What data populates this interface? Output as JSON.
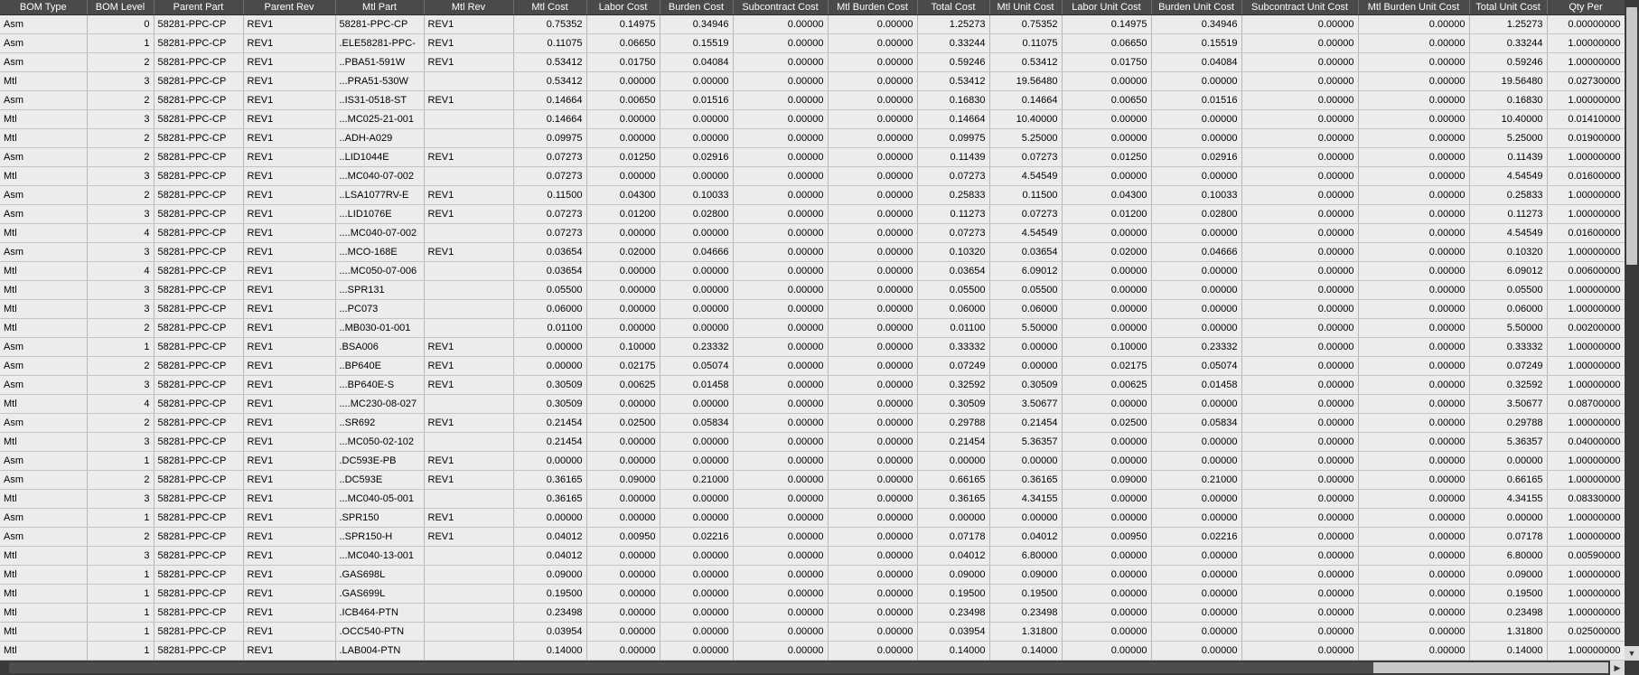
{
  "columns": [
    {
      "key": "bom_type",
      "label": "BOM Type",
      "width": 96,
      "align": "txt"
    },
    {
      "key": "bom_level",
      "label": "BOM Level",
      "width": 74,
      "align": "num"
    },
    {
      "key": "parent_part",
      "label": "Parent Part",
      "width": 99,
      "align": "txt"
    },
    {
      "key": "parent_rev",
      "label": "Parent Rev",
      "width": 102,
      "align": "txt"
    },
    {
      "key": "mtl_part",
      "label": "Mtl Part",
      "width": 98,
      "align": "txt"
    },
    {
      "key": "mtl_rev",
      "label": "Mtl Rev",
      "width": 99,
      "align": "txt"
    },
    {
      "key": "mtl_cost",
      "label": "Mtl Cost",
      "width": 81,
      "align": "num"
    },
    {
      "key": "labor_cost",
      "label": "Labor Cost",
      "width": 81,
      "align": "num"
    },
    {
      "key": "burden_cost",
      "label": "Burden Cost",
      "width": 81,
      "align": "num"
    },
    {
      "key": "subcontract_cost",
      "label": "Subcontract Cost",
      "width": 105,
      "align": "num"
    },
    {
      "key": "mtl_burden_cost",
      "label": "Mtl Burden Cost",
      "width": 99,
      "align": "num"
    },
    {
      "key": "total_cost",
      "label": "Total Cost",
      "width": 80,
      "align": "num"
    },
    {
      "key": "mtl_unit_cost",
      "label": "Mtl Unit Cost",
      "width": 80,
      "align": "num"
    },
    {
      "key": "labor_unit_cost",
      "label": "Labor Unit Cost",
      "width": 99,
      "align": "num"
    },
    {
      "key": "burden_unit_cost",
      "label": "Burden Unit Cost",
      "width": 100,
      "align": "num"
    },
    {
      "key": "subcontract_unit_cost",
      "label": "Subcontract Unit Cost",
      "width": 129,
      "align": "num"
    },
    {
      "key": "mtl_burden_unit_cost",
      "label": "Mtl Burden Unit Cost",
      "width": 123,
      "align": "num"
    },
    {
      "key": "total_unit_cost",
      "label": "Total Unit Cost",
      "width": 86,
      "align": "num"
    },
    {
      "key": "qty_per",
      "label": "Qty Per",
      "width": 86,
      "align": "num"
    }
  ],
  "rows": [
    [
      "Asm",
      "0",
      "58281-PPC-CP",
      "REV1",
      "58281-PPC-CP",
      "REV1",
      "0.75352",
      "0.14975",
      "0.34946",
      "0.00000",
      "0.00000",
      "1.25273",
      "0.75352",
      "0.14975",
      "0.34946",
      "0.00000",
      "0.00000",
      "1.25273",
      "0.00000000"
    ],
    [
      "Asm",
      "1",
      "58281-PPC-CP",
      "REV1",
      ".ELE58281-PPC-",
      "REV1",
      "0.11075",
      "0.06650",
      "0.15519",
      "0.00000",
      "0.00000",
      "0.33244",
      "0.11075",
      "0.06650",
      "0.15519",
      "0.00000",
      "0.00000",
      "0.33244",
      "1.00000000"
    ],
    [
      "Asm",
      "2",
      "58281-PPC-CP",
      "REV1",
      "..PBA51-591W",
      "REV1",
      "0.53412",
      "0.01750",
      "0.04084",
      "0.00000",
      "0.00000",
      "0.59246",
      "0.53412",
      "0.01750",
      "0.04084",
      "0.00000",
      "0.00000",
      "0.59246",
      "1.00000000"
    ],
    [
      "Mtl",
      "3",
      "58281-PPC-CP",
      "REV1",
      "...PRA51-530W",
      "",
      "0.53412",
      "0.00000",
      "0.00000",
      "0.00000",
      "0.00000",
      "0.53412",
      "19.56480",
      "0.00000",
      "0.00000",
      "0.00000",
      "0.00000",
      "19.56480",
      "0.02730000"
    ],
    [
      "Asm",
      "2",
      "58281-PPC-CP",
      "REV1",
      "..IS31-0518-ST",
      "REV1",
      "0.14664",
      "0.00650",
      "0.01516",
      "0.00000",
      "0.00000",
      "0.16830",
      "0.14664",
      "0.00650",
      "0.01516",
      "0.00000",
      "0.00000",
      "0.16830",
      "1.00000000"
    ],
    [
      "Mtl",
      "3",
      "58281-PPC-CP",
      "REV1",
      "...MC025-21-001",
      "",
      "0.14664",
      "0.00000",
      "0.00000",
      "0.00000",
      "0.00000",
      "0.14664",
      "10.40000",
      "0.00000",
      "0.00000",
      "0.00000",
      "0.00000",
      "10.40000",
      "0.01410000"
    ],
    [
      "Mtl",
      "2",
      "58281-PPC-CP",
      "REV1",
      "..ADH-A029",
      "",
      "0.09975",
      "0.00000",
      "0.00000",
      "0.00000",
      "0.00000",
      "0.09975",
      "5.25000",
      "0.00000",
      "0.00000",
      "0.00000",
      "0.00000",
      "5.25000",
      "0.01900000"
    ],
    [
      "Asm",
      "2",
      "58281-PPC-CP",
      "REV1",
      "..LID1044E",
      "REV1",
      "0.07273",
      "0.01250",
      "0.02916",
      "0.00000",
      "0.00000",
      "0.11439",
      "0.07273",
      "0.01250",
      "0.02916",
      "0.00000",
      "0.00000",
      "0.11439",
      "1.00000000"
    ],
    [
      "Mtl",
      "3",
      "58281-PPC-CP",
      "REV1",
      "...MC040-07-002",
      "",
      "0.07273",
      "0.00000",
      "0.00000",
      "0.00000",
      "0.00000",
      "0.07273",
      "4.54549",
      "0.00000",
      "0.00000",
      "0.00000",
      "0.00000",
      "4.54549",
      "0.01600000"
    ],
    [
      "Asm",
      "2",
      "58281-PPC-CP",
      "REV1",
      "..LSA1077RV-E",
      "REV1",
      "0.11500",
      "0.04300",
      "0.10033",
      "0.00000",
      "0.00000",
      "0.25833",
      "0.11500",
      "0.04300",
      "0.10033",
      "0.00000",
      "0.00000",
      "0.25833",
      "1.00000000"
    ],
    [
      "Asm",
      "3",
      "58281-PPC-CP",
      "REV1",
      "...LID1076E",
      "REV1",
      "0.07273",
      "0.01200",
      "0.02800",
      "0.00000",
      "0.00000",
      "0.11273",
      "0.07273",
      "0.01200",
      "0.02800",
      "0.00000",
      "0.00000",
      "0.11273",
      "1.00000000"
    ],
    [
      "Mtl",
      "4",
      "58281-PPC-CP",
      "REV1",
      "....MC040-07-002",
      "",
      "0.07273",
      "0.00000",
      "0.00000",
      "0.00000",
      "0.00000",
      "0.07273",
      "4.54549",
      "0.00000",
      "0.00000",
      "0.00000",
      "0.00000",
      "4.54549",
      "0.01600000"
    ],
    [
      "Asm",
      "3",
      "58281-PPC-CP",
      "REV1",
      "...MCO-168E",
      "REV1",
      "0.03654",
      "0.02000",
      "0.04666",
      "0.00000",
      "0.00000",
      "0.10320",
      "0.03654",
      "0.02000",
      "0.04666",
      "0.00000",
      "0.00000",
      "0.10320",
      "1.00000000"
    ],
    [
      "Mtl",
      "4",
      "58281-PPC-CP",
      "REV1",
      "....MC050-07-006",
      "",
      "0.03654",
      "0.00000",
      "0.00000",
      "0.00000",
      "0.00000",
      "0.03654",
      "6.09012",
      "0.00000",
      "0.00000",
      "0.00000",
      "0.00000",
      "6.09012",
      "0.00600000"
    ],
    [
      "Mtl",
      "3",
      "58281-PPC-CP",
      "REV1",
      "...SPR131",
      "",
      "0.05500",
      "0.00000",
      "0.00000",
      "0.00000",
      "0.00000",
      "0.05500",
      "0.05500",
      "0.00000",
      "0.00000",
      "0.00000",
      "0.00000",
      "0.05500",
      "1.00000000"
    ],
    [
      "Mtl",
      "3",
      "58281-PPC-CP",
      "REV1",
      "...PC073",
      "",
      "0.06000",
      "0.00000",
      "0.00000",
      "0.00000",
      "0.00000",
      "0.06000",
      "0.06000",
      "0.00000",
      "0.00000",
      "0.00000",
      "0.00000",
      "0.06000",
      "1.00000000"
    ],
    [
      "Mtl",
      "2",
      "58281-PPC-CP",
      "REV1",
      "..MB030-01-001",
      "",
      "0.01100",
      "0.00000",
      "0.00000",
      "0.00000",
      "0.00000",
      "0.01100",
      "5.50000",
      "0.00000",
      "0.00000",
      "0.00000",
      "0.00000",
      "5.50000",
      "0.00200000"
    ],
    [
      "Asm",
      "1",
      "58281-PPC-CP",
      "REV1",
      ".BSA006",
      "REV1",
      "0.00000",
      "0.10000",
      "0.23332",
      "0.00000",
      "0.00000",
      "0.33332",
      "0.00000",
      "0.10000",
      "0.23332",
      "0.00000",
      "0.00000",
      "0.33332",
      "1.00000000"
    ],
    [
      "Asm",
      "2",
      "58281-PPC-CP",
      "REV1",
      "..BP640E",
      "REV1",
      "0.00000",
      "0.02175",
      "0.05074",
      "0.00000",
      "0.00000",
      "0.07249",
      "0.00000",
      "0.02175",
      "0.05074",
      "0.00000",
      "0.00000",
      "0.07249",
      "1.00000000"
    ],
    [
      "Asm",
      "3",
      "58281-PPC-CP",
      "REV1",
      "...BP640E-S",
      "REV1",
      "0.30509",
      "0.00625",
      "0.01458",
      "0.00000",
      "0.00000",
      "0.32592",
      "0.30509",
      "0.00625",
      "0.01458",
      "0.00000",
      "0.00000",
      "0.32592",
      "1.00000000"
    ],
    [
      "Mtl",
      "4",
      "58281-PPC-CP",
      "REV1",
      "....MC230-08-027",
      "",
      "0.30509",
      "0.00000",
      "0.00000",
      "0.00000",
      "0.00000",
      "0.30509",
      "3.50677",
      "0.00000",
      "0.00000",
      "0.00000",
      "0.00000",
      "3.50677",
      "0.08700000"
    ],
    [
      "Asm",
      "2",
      "58281-PPC-CP",
      "REV1",
      "..SR692",
      "REV1",
      "0.21454",
      "0.02500",
      "0.05834",
      "0.00000",
      "0.00000",
      "0.29788",
      "0.21454",
      "0.02500",
      "0.05834",
      "0.00000",
      "0.00000",
      "0.29788",
      "1.00000000"
    ],
    [
      "Mtl",
      "3",
      "58281-PPC-CP",
      "REV1",
      "...MC050-02-102",
      "",
      "0.21454",
      "0.00000",
      "0.00000",
      "0.00000",
      "0.00000",
      "0.21454",
      "5.36357",
      "0.00000",
      "0.00000",
      "0.00000",
      "0.00000",
      "5.36357",
      "0.04000000"
    ],
    [
      "Asm",
      "1",
      "58281-PPC-CP",
      "REV1",
      ".DC593E-PB",
      "REV1",
      "0.00000",
      "0.00000",
      "0.00000",
      "0.00000",
      "0.00000",
      "0.00000",
      "0.00000",
      "0.00000",
      "0.00000",
      "0.00000",
      "0.00000",
      "0.00000",
      "1.00000000"
    ],
    [
      "Asm",
      "2",
      "58281-PPC-CP",
      "REV1",
      "..DC593E",
      "REV1",
      "0.36165",
      "0.09000",
      "0.21000",
      "0.00000",
      "0.00000",
      "0.66165",
      "0.36165",
      "0.09000",
      "0.21000",
      "0.00000",
      "0.00000",
      "0.66165",
      "1.00000000"
    ],
    [
      "Mtl",
      "3",
      "58281-PPC-CP",
      "REV1",
      "...MC040-05-001",
      "",
      "0.36165",
      "0.00000",
      "0.00000",
      "0.00000",
      "0.00000",
      "0.36165",
      "4.34155",
      "0.00000",
      "0.00000",
      "0.00000",
      "0.00000",
      "4.34155",
      "0.08330000"
    ],
    [
      "Asm",
      "1",
      "58281-PPC-CP",
      "REV1",
      ".SPR150",
      "REV1",
      "0.00000",
      "0.00000",
      "0.00000",
      "0.00000",
      "0.00000",
      "0.00000",
      "0.00000",
      "0.00000",
      "0.00000",
      "0.00000",
      "0.00000",
      "0.00000",
      "1.00000000"
    ],
    [
      "Asm",
      "2",
      "58281-PPC-CP",
      "REV1",
      "..SPR150-H",
      "REV1",
      "0.04012",
      "0.00950",
      "0.02216",
      "0.00000",
      "0.00000",
      "0.07178",
      "0.04012",
      "0.00950",
      "0.02216",
      "0.00000",
      "0.00000",
      "0.07178",
      "1.00000000"
    ],
    [
      "Mtl",
      "3",
      "58281-PPC-CP",
      "REV1",
      "...MC040-13-001",
      "",
      "0.04012",
      "0.00000",
      "0.00000",
      "0.00000",
      "0.00000",
      "0.04012",
      "6.80000",
      "0.00000",
      "0.00000",
      "0.00000",
      "0.00000",
      "6.80000",
      "0.00590000"
    ],
    [
      "Mtl",
      "1",
      "58281-PPC-CP",
      "REV1",
      ".GAS698L",
      "",
      "0.09000",
      "0.00000",
      "0.00000",
      "0.00000",
      "0.00000",
      "0.09000",
      "0.09000",
      "0.00000",
      "0.00000",
      "0.00000",
      "0.00000",
      "0.09000",
      "1.00000000"
    ],
    [
      "Mtl",
      "1",
      "58281-PPC-CP",
      "REV1",
      ".GAS699L",
      "",
      "0.19500",
      "0.00000",
      "0.00000",
      "0.00000",
      "0.00000",
      "0.19500",
      "0.19500",
      "0.00000",
      "0.00000",
      "0.00000",
      "0.00000",
      "0.19500",
      "1.00000000"
    ],
    [
      "Mtl",
      "1",
      "58281-PPC-CP",
      "REV1",
      ".ICB464-PTN",
      "",
      "0.23498",
      "0.00000",
      "0.00000",
      "0.00000",
      "0.00000",
      "0.23498",
      "0.23498",
      "0.00000",
      "0.00000",
      "0.00000",
      "0.00000",
      "0.23498",
      "1.00000000"
    ],
    [
      "Mtl",
      "1",
      "58281-PPC-CP",
      "REV1",
      ".OCC540-PTN",
      "",
      "0.03954",
      "0.00000",
      "0.00000",
      "0.00000",
      "0.00000",
      "0.03954",
      "1.31800",
      "0.00000",
      "0.00000",
      "0.00000",
      "0.00000",
      "1.31800",
      "0.02500000"
    ],
    [
      "Mtl",
      "1",
      "58281-PPC-CP",
      "REV1",
      ".LAB004-PTN",
      "",
      "0.14000",
      "0.00000",
      "0.00000",
      "0.00000",
      "0.00000",
      "0.14000",
      "0.14000",
      "0.00000",
      "0.00000",
      "0.00000",
      "0.00000",
      "0.14000",
      "1.00000000"
    ]
  ],
  "scrollbars": {
    "vertical": {
      "up_arrow": "▲",
      "down_arrow": "▼",
      "up_icon": "arrow-up-icon",
      "down_icon": "arrow-down-icon"
    },
    "horizontal": {
      "right_arrow": "▶",
      "right_icon": "arrow-right-icon"
    }
  }
}
